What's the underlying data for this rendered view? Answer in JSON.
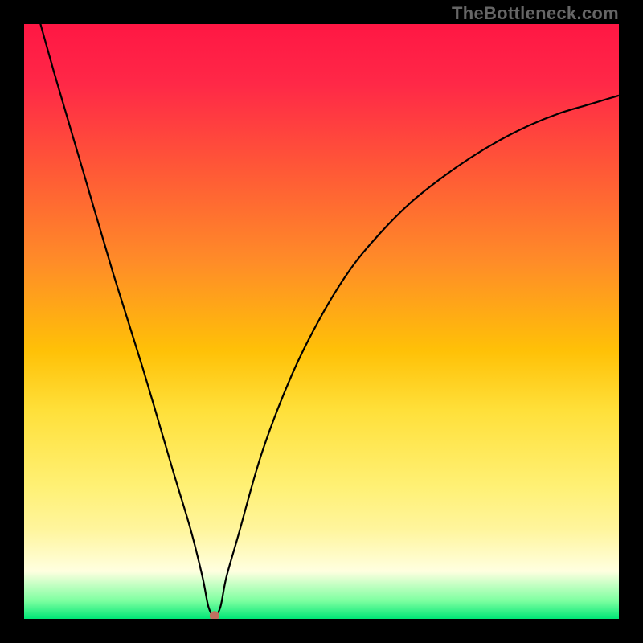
{
  "watermark": "TheBottleneck.com",
  "chart_data": {
    "type": "line",
    "title": "",
    "xlabel": "",
    "ylabel": "",
    "xlim": [
      0,
      100
    ],
    "ylim": [
      0,
      100
    ],
    "series": [
      {
        "name": "bottleneck-curve",
        "x": [
          0,
          5,
          10,
          15,
          20,
          25,
          28,
          30,
          31,
          32,
          33,
          34,
          36,
          40,
          45,
          50,
          55,
          60,
          65,
          70,
          75,
          80,
          85,
          90,
          95,
          100
        ],
        "y": [
          110,
          92,
          75,
          58,
          42,
          25,
          15,
          7,
          2,
          0.5,
          2,
          7,
          14,
          28,
          41,
          51,
          59,
          65,
          70,
          74,
          77.5,
          80.5,
          83,
          85,
          86.5,
          88
        ]
      }
    ],
    "marker": {
      "x": 32,
      "y": 0.5,
      "color": "#c07060",
      "radius": 6
    },
    "gradient_stops": [
      {
        "pos": 0.0,
        "color": "#ff1744"
      },
      {
        "pos": 0.55,
        "color": "#ffc107"
      },
      {
        "pos": 0.92,
        "color": "#ffffe0"
      },
      {
        "pos": 1.0,
        "color": "#00e676"
      }
    ],
    "axis_color": "#000000"
  }
}
